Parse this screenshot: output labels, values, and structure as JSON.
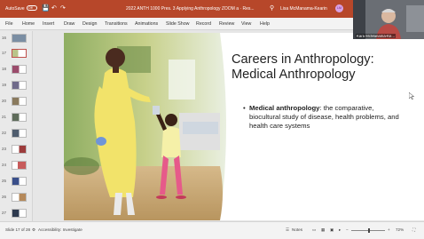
{
  "titlebar": {
    "autosave_label": "AutoSave",
    "autosave_state": "Off",
    "doc_title": "2022 ANTH 1000 Pres. 3 Applying Anthropology ZOOM a  ·  Res...",
    "user_name": "Lisa McManama-Kearin",
    "avatar_initials": "LM",
    "accent_color": "#b7472a"
  },
  "ribbon": {
    "tabs": [
      "File",
      "Home",
      "Insert",
      "Draw",
      "Design",
      "Transitions",
      "Animations",
      "Slide Show",
      "Record",
      "Review",
      "View",
      "Help"
    ]
  },
  "thumbnails": {
    "numbers": [
      "16",
      "17",
      "18",
      "19",
      "20",
      "21",
      "22",
      "23",
      "24",
      "25",
      "26",
      "27"
    ],
    "active_number": "17"
  },
  "slide": {
    "title": "Careers in  Anthropology: Medical Anthropology",
    "bullet_term": "Medical anthropology",
    "bullet_text": ":  the comparative, biocultural study of disease, health problems, and health care systems"
  },
  "statusbar": {
    "slide_info": "Slide 17 of 28",
    "accessibility": "Accessibility: Investigate",
    "notes": "Notes",
    "zoom": "72%"
  },
  "video": {
    "participant_name": "Kara McManama-Ke..."
  }
}
